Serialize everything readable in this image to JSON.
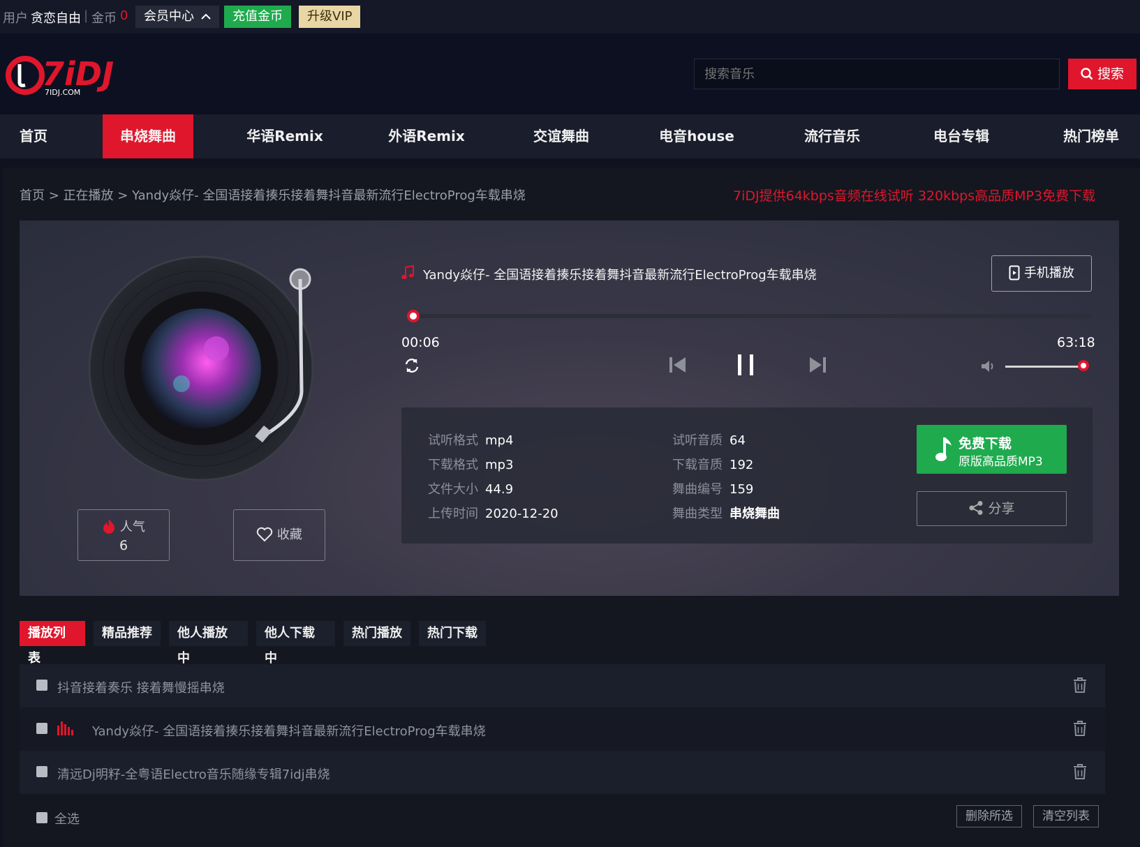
{
  "topbar": {
    "user_label": "用户",
    "username": "贪恋自由",
    "separator": "|",
    "coin_label": "金币",
    "coin_count": "0",
    "member_center": "会员中心",
    "recharge": "充值金币",
    "upgrade_vip": "升级VIP"
  },
  "header": {
    "logo_text": "7iDJ",
    "logo_sub": "7IDJ.COM",
    "search_placeholder": "搜索音乐",
    "search_button": "搜索"
  },
  "nav": {
    "items": [
      "首页",
      "串烧舞曲",
      "华语Remix",
      "外语Remix",
      "交谊舞曲",
      "电音house",
      "流行音乐",
      "电台专辑",
      "热门榜单"
    ],
    "active_index": 1
  },
  "breadcrumb": {
    "home": "首页",
    "now_playing": "正在播放",
    "sep": ">",
    "current": "Yandy焱仔- 全国语接着揍乐接着舞抖音最新流行ElectroProg车载串烧"
  },
  "promo": "7iDJ提供64kbps音频在线试听 320kbps高品质MP3免费下载",
  "player": {
    "title": "Yandy焱仔- 全国语接着揍乐接着舞抖音最新流行ElectroProg车载串烧",
    "mobile_play": "手机播放",
    "current_time": "00:06",
    "total_time": "63:18",
    "progress_fraction": 0.008,
    "volume_fraction": 0.95,
    "popularity_label": "人气",
    "popularity_count": "6",
    "favorite_label": "收藏"
  },
  "info": {
    "trial_format_k": "试听格式",
    "trial_format_v": "mp4",
    "download_format_k": "下载格式",
    "download_format_v": "mp3",
    "file_size_k": "文件大小",
    "file_size_v": "44.9",
    "upload_time_k": "上传时间",
    "upload_time_v": "2020-12-20",
    "trial_quality_k": "试听音质",
    "trial_quality_v": "64",
    "download_quality_k": "下载音质",
    "download_quality_v": "192",
    "song_id_k": "舞曲编号",
    "song_id_v": "159",
    "song_type_k": "舞曲类型",
    "song_type_v": "串烧舞曲",
    "download_btn_main": "免费下载",
    "download_btn_sub": "原版高品质MP3",
    "share": "分享"
  },
  "tabs": [
    "播放列表",
    "精品推荐",
    "他人播放中",
    "他人下载中",
    "热门播放",
    "热门下载"
  ],
  "playlist": [
    "抖音接着奏乐 接着舞慢摇串烧",
    "Yandy焱仔- 全国语接着揍乐接着舞抖音最新流行ElectroProg车载串烧",
    "清远Dj明籽-全粤语Electro音乐随缘专辑7idj串烧"
  ],
  "footer": {
    "select_all": "全选",
    "delete_selected": "删除所选",
    "clear_list": "清空列表"
  },
  "colors": {
    "accent": "#e0162d",
    "green": "#1faa4e",
    "vip_gold": "#e8d6a4",
    "background": "#10131f"
  }
}
